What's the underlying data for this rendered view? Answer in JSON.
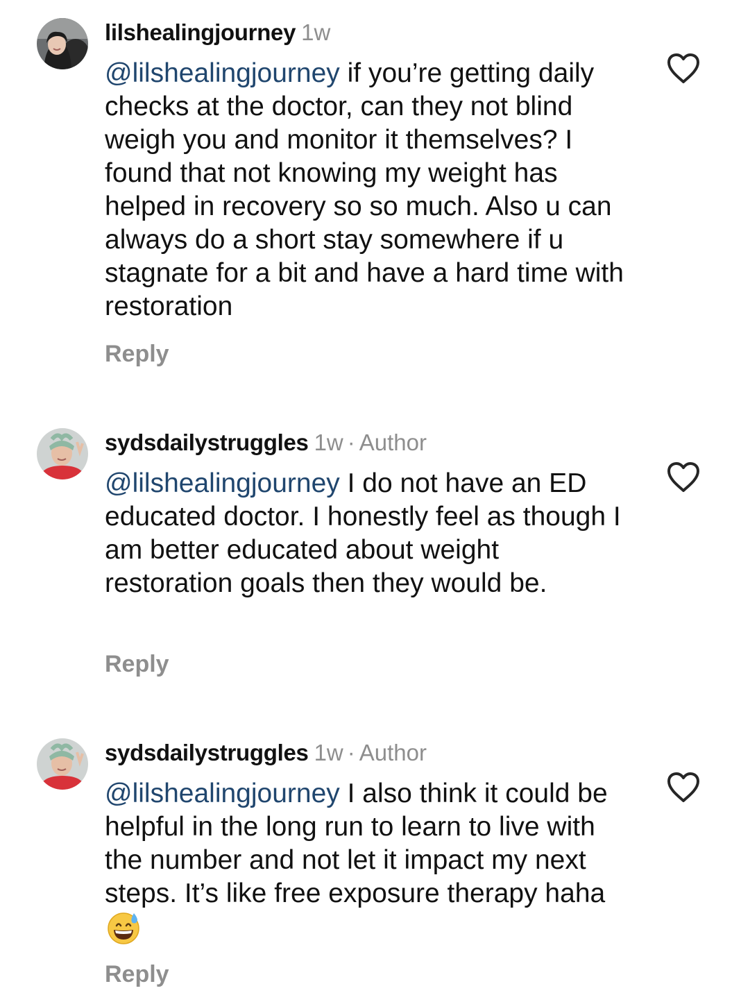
{
  "comments": [
    {
      "username": "lilshealingjourney",
      "time": "1w",
      "author_badge": "",
      "mention": "@lilshealingjourney",
      "text": "if you’re getting daily checks at the doctor, can they not blind weigh you and monitor it themselves? I found that not knowing my weight has helped in recovery so so much. Also u can always do a short stay somewhere if u stagnate for a bit and have a hard time with restoration",
      "reply_label": "Reply",
      "like_icon": "heart-outline-icon",
      "avatar_icon": "profile-photo-woman-icon"
    },
    {
      "username": "sydsdailystruggles",
      "time": "1w",
      "separator": "·",
      "author_badge": "Author",
      "mention": "@lilshealingjourney",
      "text": "I do not have an ED educated doctor. I honestly feel as though I am better educated about weight restoration goals then they would be.",
      "reply_label": "Reply",
      "like_icon": "heart-outline-icon",
      "avatar_icon": "profile-photo-person-headband-icon"
    },
    {
      "username": "sydsdailystruggles",
      "time": "1w",
      "separator": "·",
      "author_badge": "Author",
      "mention": "@lilshealingjourney",
      "text": "I also think it could be helpful in the long run to learn to live with the number and not let it impact my next steps. It’s like free exposure therapy haha",
      "emoji": "grinning-face-with-sweat-emoji",
      "reply_label": "Reply",
      "like_icon": "heart-outline-icon",
      "avatar_icon": "profile-photo-person-headband-icon"
    }
  ],
  "colors": {
    "mention": "#20466e",
    "meta": "#8e8e8e",
    "text": "#111111"
  }
}
